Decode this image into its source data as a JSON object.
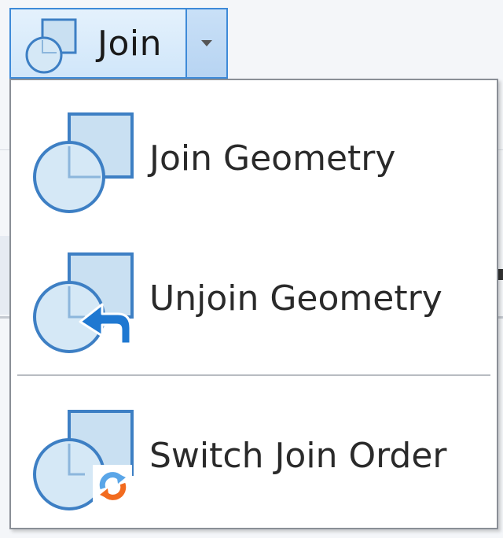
{
  "split_button": {
    "label": "Join",
    "icon": "join-geometry-icon",
    "arrow_icon": "caret-down-icon"
  },
  "menu": {
    "items": [
      {
        "label": "Join Geometry",
        "icon": "join-geometry-icon"
      },
      {
        "label": "Unjoin Geometry",
        "icon": "unjoin-geometry-icon"
      },
      {
        "label": "Switch Join Order",
        "icon": "switch-join-order-icon"
      }
    ]
  },
  "colors": {
    "accent_border": "#3e8ad8",
    "shape_fill": "#c9e0f2",
    "shape_stroke": "#3d7fc4",
    "arrow_blue": "#1f78d1",
    "switch_orange": "#f26b1f"
  }
}
